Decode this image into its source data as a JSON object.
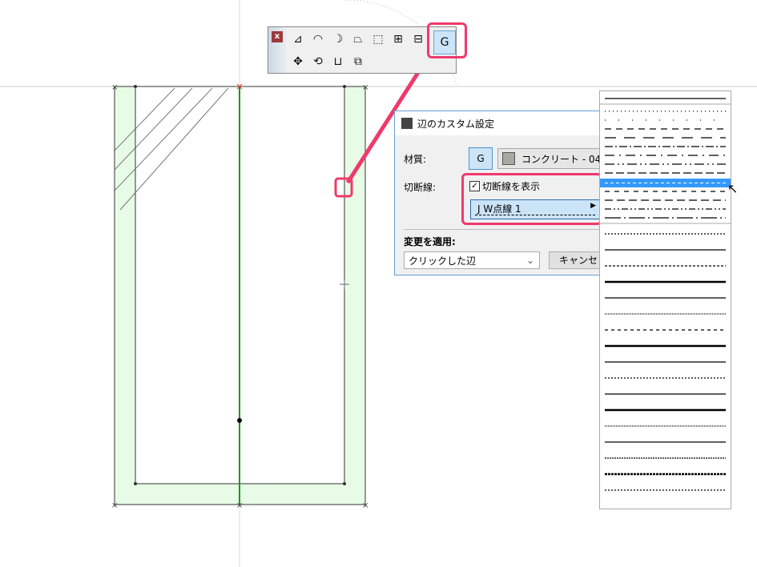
{
  "toolbar": {
    "close_label": "x",
    "icons_row1": [
      "angle-icon",
      "arc-icon",
      "curve-icon",
      "edge-offset-icon",
      "edge-offset-dotted-icon",
      "add-vertex-icon",
      "remove-vertex-icon",
      "custom-edge-settings-icon"
    ],
    "icons_row2": [
      "move-icon",
      "rotate-icon",
      "mirror-icon",
      "resize-icon"
    ]
  },
  "dialog": {
    "title": "辺のカスタム設定",
    "material_label": "材質:",
    "material_value": "コンクリート - 04",
    "material_swatch": "#a8a8a0",
    "cutline_label": "切断線:",
    "show_cutline_label": "切断線を表示",
    "show_cutline_checked": true,
    "linetype_value": "J W点線 1",
    "apply_label": "変更を適用:",
    "apply_value": "クリックした辺",
    "cancel_label": "キャンセル"
  },
  "colors": {
    "accent": "#ee3a6c",
    "wall_fill": "#e8fbe6",
    "green_line": "#1a9a1a",
    "selected": "#3399ff"
  }
}
